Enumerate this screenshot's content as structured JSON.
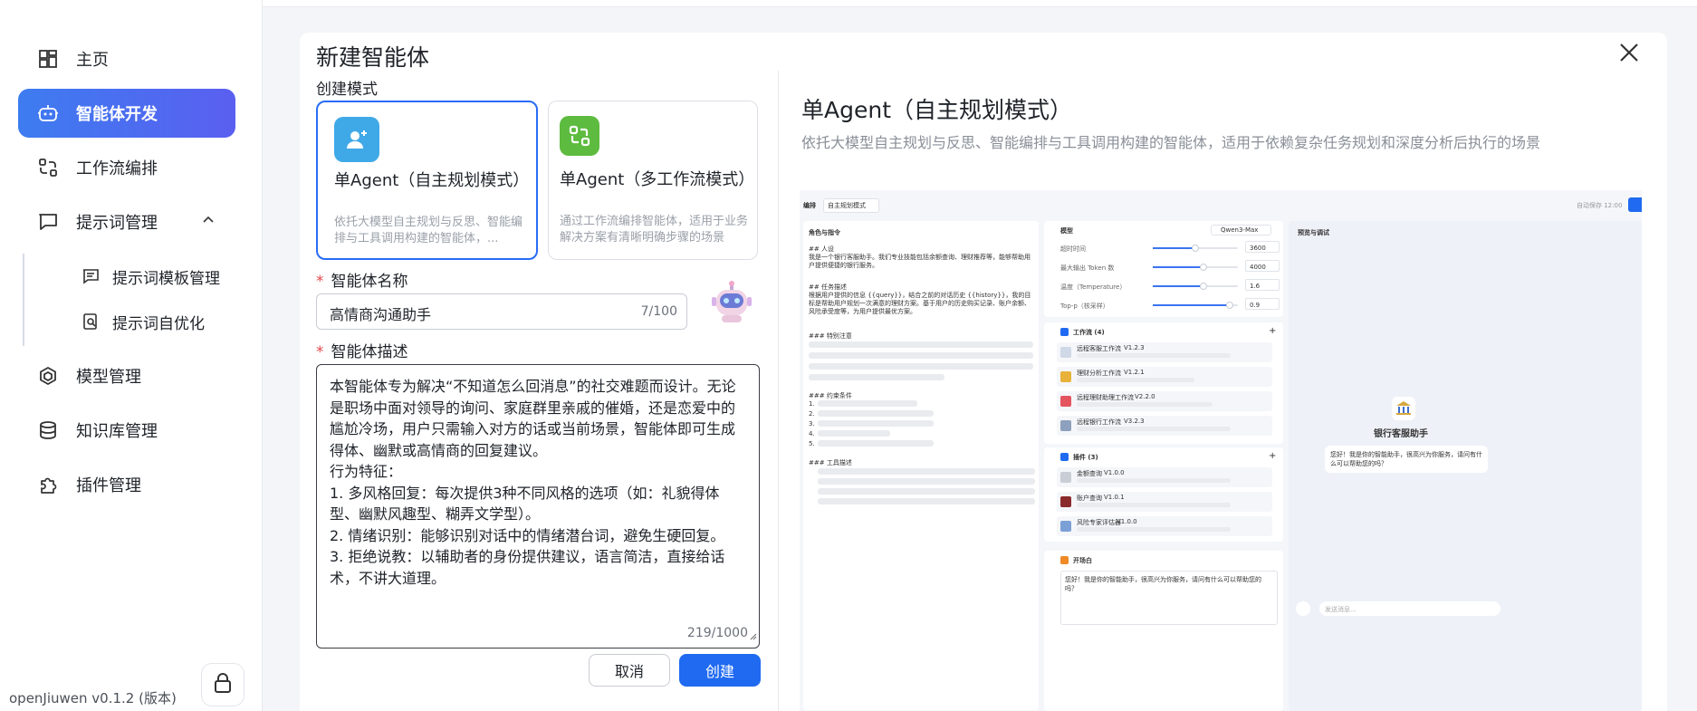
{
  "sidebar": {
    "items": [
      {
        "label": "主页",
        "icon": "dashboard-icon"
      },
      {
        "label": "智能体开发",
        "icon": "robot-icon"
      },
      {
        "label": "工作流编排",
        "icon": "workflow-icon"
      },
      {
        "label": "提示词管理",
        "icon": "chat-icon"
      },
      {
        "label": "模型管理",
        "icon": "cube-icon"
      },
      {
        "label": "知识库管理",
        "icon": "database-icon"
      },
      {
        "label": "插件管理",
        "icon": "puzzle-icon"
      }
    ],
    "sub_items": [
      {
        "label": "提示词模板管理",
        "icon": "template-icon"
      },
      {
        "label": "提示词自优化",
        "icon": "optimize-icon"
      }
    ],
    "version": "openJiuwen v0.1.2 (版本)"
  },
  "modal": {
    "title": "新建智能体",
    "mode_label": "创建模式",
    "modes": [
      {
        "title": "单Agent（自主规划模式）",
        "desc": "依托大模型自主规划与反思、智能编排与工具调用构建的智能体，..."
      },
      {
        "title": "单Agent（多工作流模式）",
        "desc": "通过工作流编排智能体，适用于业务解决方案有清晰明确步骤的场景"
      }
    ],
    "name_label": "智能体名称",
    "name_value": "高情商沟通助手",
    "name_counter": "7/100",
    "desc_label": "智能体描述",
    "desc_value": "本智能体专为解决“不知道怎么回消息”的社交难题而设计。无论是职场中面对领导的询问、家庭群里亲戚的催婚，还是恋爱中的尴尬冷场，用户只需输入对方的话或当前场景，智能体即可生成得体、幽默或高情商的回复建议。\n行为特征：\n1. 多风格回复：每次提供3种不同风格的选项（如：礼貌得体型、幽默风趣型、糊弄文学型）。\n2. 情绪识别：能够识别对话中的情绪潜台词，避免生硬回复。\n3. 拒绝说教：以辅助者的身份提供建议，语言简洁，直接给话术，不讲大道理。",
    "desc_counter": "219/1000",
    "cancel": "取消",
    "create": "创建"
  },
  "preview": {
    "title": "单Agent（自主规划模式）",
    "subtitle": "依托大模型自主规划与反思、智能编排与工具调用构建的智能体，适用于依赖复杂任务规划和深度分析后执行的场景",
    "toolbar": {
      "label": "编排",
      "mode": "自主规划模式",
      "autosave": "自动保存 12:00"
    },
    "prompt_panel": {
      "title": "角色与指令",
      "h1": "## 人设",
      "p1": "我是一个银行客服助手。我们专业技能包括余额查询、理财推荐等，能够帮助用户提供便捷的银行服务。",
      "h2": "## 任务描述",
      "p2": "根据用户提供的信息 {{query}}，结合之前的对话历史 {{history}}，我的目标是帮助用户规划一次满意的理财方案。基于用户的历史购买记录、账户余额、风险承受度等，为用户提供最优方案。",
      "h3": "### 特别注意",
      "h4": "### 约束条件",
      "list": [
        "1.",
        "2.",
        "3.",
        "4.",
        "5."
      ],
      "h5": "### 工具描述"
    },
    "model_panel": {
      "title": "模型",
      "model": "Qwen3-Max",
      "params": [
        {
          "label": "超时时间",
          "value": "3600",
          "fill": 0.5
        },
        {
          "label": "最大输出 Token 数",
          "value": "4000",
          "fill": 0.6
        },
        {
          "label": "温度（Temperature）",
          "value": "1.6",
          "fill": 0.6
        },
        {
          "label": "Top-p（核采样）",
          "value": "0.9",
          "fill": 0.9
        }
      ]
    },
    "workflow_panel": {
      "title": "工作流 (4)",
      "items": [
        {
          "name": "远程客服工作流",
          "ver": "V1.2.3"
        },
        {
          "name": "理财分析工作流",
          "ver": "V1.2.1"
        },
        {
          "name": "远程理财助理工作流",
          "ver": "V2.2.0"
        },
        {
          "name": "远程银行工作流",
          "ver": "V3.2.3"
        }
      ]
    },
    "plugin_panel": {
      "title": "插件 (3)",
      "items": [
        {
          "name": "金额查询",
          "ver": "V1.0.0"
        },
        {
          "name": "账户查询",
          "ver": "V1.0.1"
        },
        {
          "name": "风险专家评估器",
          "ver": "V1.0.0"
        }
      ]
    },
    "opening_panel": {
      "title": "开场白",
      "text": "您好！我是你的智能助手，很高兴为你服务，请问有什么可以帮助您的吗？"
    },
    "debug_panel": {
      "title": "预览与调试",
      "bot_name": "银行客服助手",
      "greeting": "您好！我是你的智能助手，很高兴为你服务，请问有什么可以帮助您的吗？",
      "input_placeholder": "发送消息..."
    }
  },
  "colors": {
    "accent": "#1f6af0",
    "active_nav_start": "#3d7cf0",
    "active_nav_end": "#5a5ff0"
  }
}
